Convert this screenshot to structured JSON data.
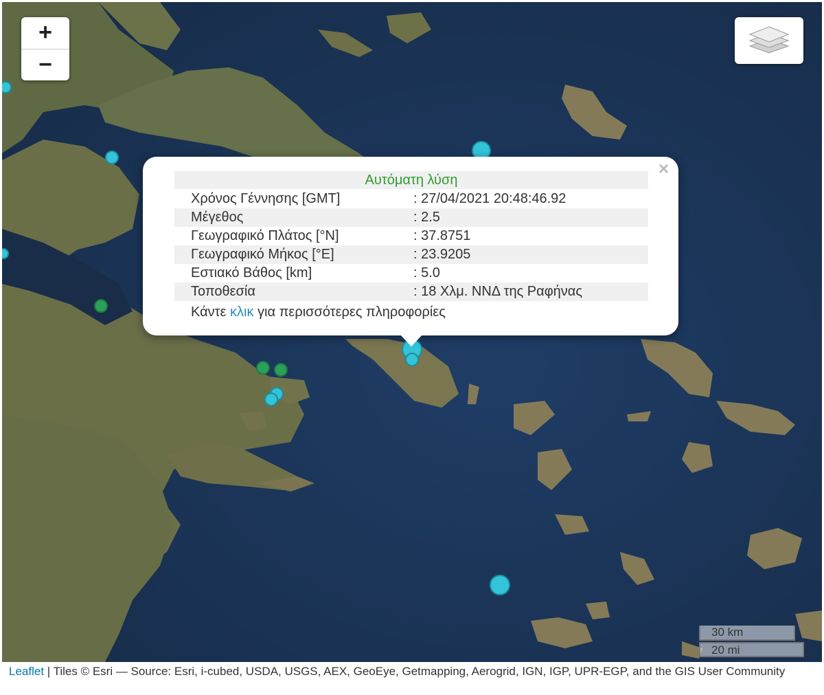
{
  "controls": {
    "zoom_in": "+",
    "zoom_out": "−",
    "close": "×"
  },
  "popup": {
    "title": "Αυτόματη λύση",
    "rows": [
      {
        "label": "Χρόνος Γέννησης [GMT]",
        "value": ": 27/04/2021 20:48:46.92"
      },
      {
        "label": "Μέγεθος",
        "value": ": 2.5"
      },
      {
        "label": "Γεωγραφικό Πλάτος [°N]",
        "value": ": 37.8751"
      },
      {
        "label": "Γεωγραφικό Μήκος [°E]",
        "value": ": 23.9205"
      },
      {
        "label": "Εστιακό Βάθος [km]",
        "value": ": 5.0"
      },
      {
        "label": "Τοποθεσία",
        "value": ": 18 Χλμ. ΝΝΔ της Ραφήνας"
      }
    ],
    "more_prefix": "Κάντε ",
    "more_link": "κλικ",
    "more_suffix": " για περισσότερες πληροφορίες"
  },
  "scale": {
    "km": "30 km",
    "mi": "20 mi"
  },
  "attribution": {
    "leaflet": "Leaflet",
    "text": " | Tiles © Esri — Source: Esri, i-cubed, USDA, USGS, AEX, GeoEye, Getmapping, Aerogrid, IGN, IGP, UPR-EGP, and the GIS User Community"
  },
  "colors": {
    "marker_cyan": "#33c4d8",
    "marker_green": "#2aa05a",
    "title_green": "#2e9d2e",
    "link": "#2a8fb3"
  },
  "icons": {
    "layers": "layers-icon",
    "close": "close-icon"
  }
}
